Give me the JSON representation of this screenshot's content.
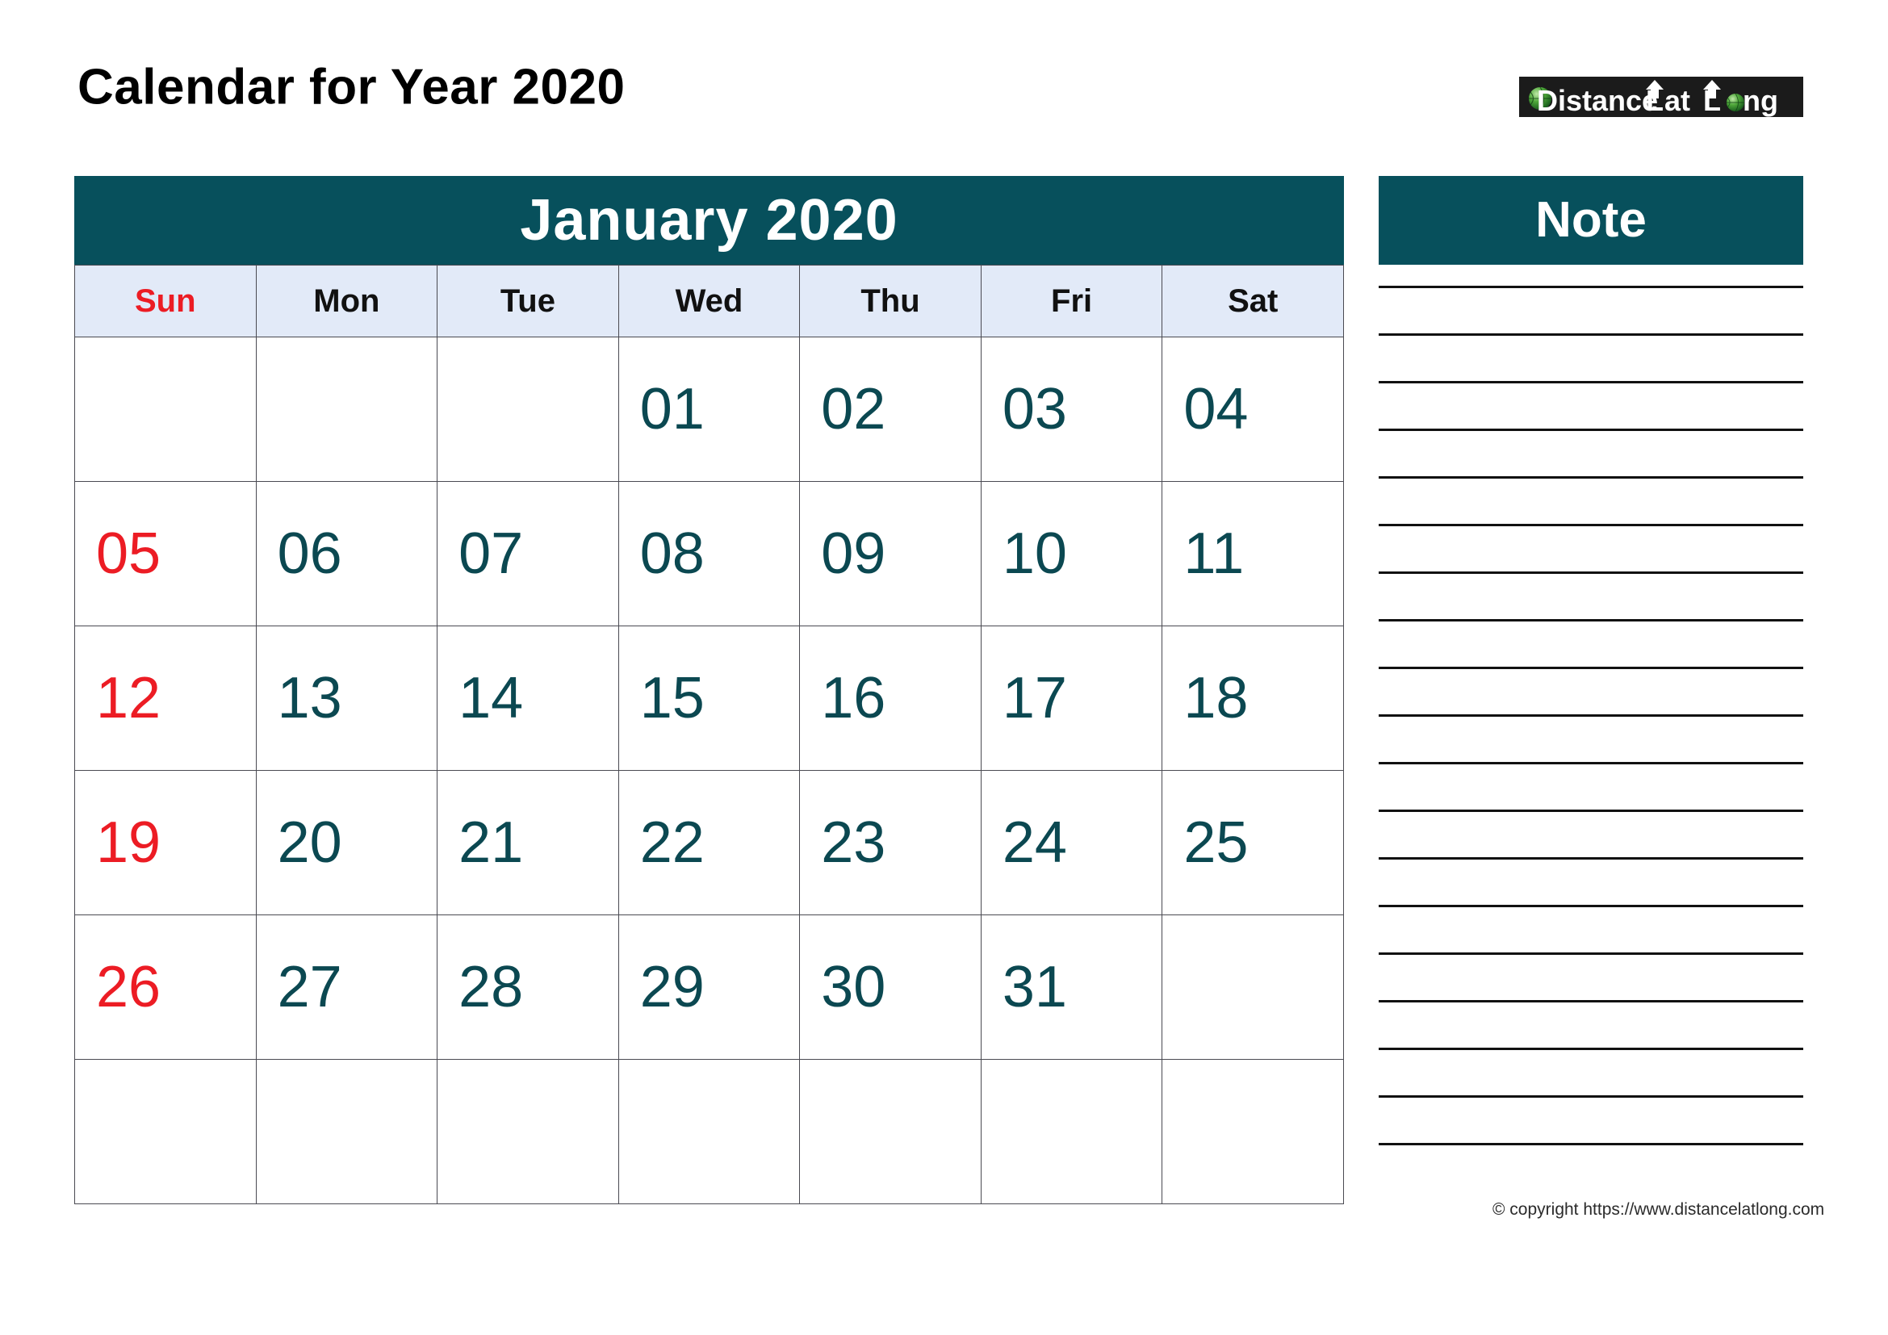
{
  "page": {
    "title": "Calendar for Year 2020",
    "copyright": "© copyright https://www.distancelatlong.com"
  },
  "brand": {
    "name": "DistanceLatLong",
    "part1": "D",
    "part2": "istance",
    "part3": "L",
    "part4": "at",
    "part5": "L",
    "part6": "ng",
    "background": "#1b1b1b",
    "text_color": "#ffffff"
  },
  "calendar": {
    "month_title": "January 2020",
    "header_bg": "#07505c",
    "header_text": "#ffffff",
    "weekday_bg": "#e2eaf8",
    "date_color": "#0b4851",
    "sunday_color": "#ec1c24",
    "grid_border": "#4a4a52",
    "weekdays": [
      {
        "label": "Sun",
        "weekend": true
      },
      {
        "label": "Mon",
        "weekend": false
      },
      {
        "label": "Tue",
        "weekend": false
      },
      {
        "label": "Wed",
        "weekend": false
      },
      {
        "label": "Thu",
        "weekend": false
      },
      {
        "label": "Fri",
        "weekend": false
      },
      {
        "label": "Sat",
        "weekend": false
      }
    ],
    "weeks": [
      [
        "",
        "",
        "",
        "01",
        "02",
        "03",
        "04"
      ],
      [
        "05",
        "06",
        "07",
        "08",
        "09",
        "10",
        "11"
      ],
      [
        "12",
        "13",
        "14",
        "15",
        "16",
        "17",
        "18"
      ],
      [
        "19",
        "20",
        "21",
        "22",
        "23",
        "24",
        "25"
      ],
      [
        "26",
        "27",
        "28",
        "29",
        "30",
        "31",
        ""
      ],
      [
        "",
        "",
        "",
        "",
        "",
        "",
        ""
      ]
    ]
  },
  "note": {
    "title": "Note",
    "header_bg": "#07505c",
    "line_count": 19,
    "line_color": "#111111"
  }
}
